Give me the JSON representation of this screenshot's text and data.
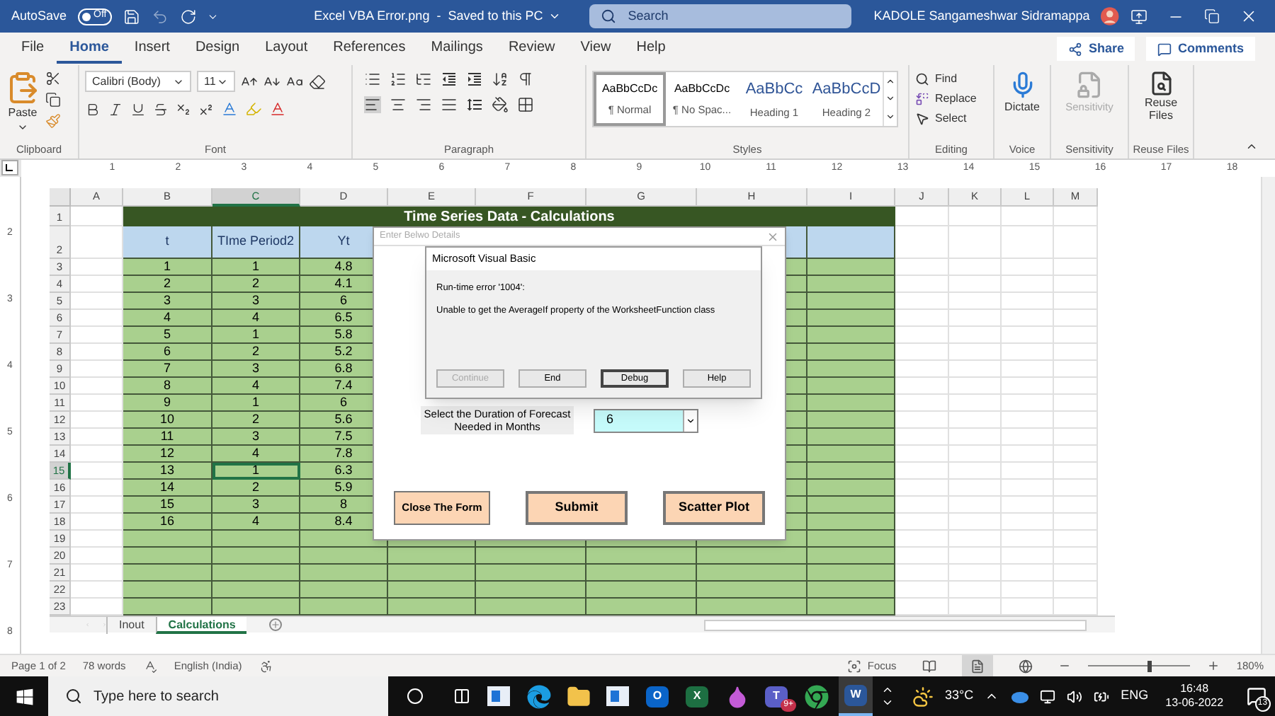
{
  "title_bar": {
    "autosave_label": "AutoSave",
    "autosave": {
      "on": false,
      "label": "Off"
    },
    "document_title": "Excel VBA Error.png  -  Saved to this PC",
    "search_placeholder": "Search",
    "user_name": "KADOLE Sangameshwar Sidramappa"
  },
  "ribbon_tabs": [
    {
      "label": "File",
      "selected": false
    },
    {
      "label": "Home",
      "selected": true
    },
    {
      "label": "Insert",
      "selected": false
    },
    {
      "label": "Design",
      "selected": false
    },
    {
      "label": "Layout",
      "selected": false
    },
    {
      "label": "References",
      "selected": false
    },
    {
      "label": "Mailings",
      "selected": false
    },
    {
      "label": "Review",
      "selected": false
    },
    {
      "label": "View",
      "selected": false
    },
    {
      "label": "Help",
      "selected": false
    }
  ],
  "share": "Share",
  "comments": "Comments",
  "ribbon": {
    "clipboard": {
      "paste": "Paste",
      "group": "Clipboard"
    },
    "font": {
      "name": "Calibri (Body)",
      "size": "11",
      "group": "Font"
    },
    "paragraph": {
      "group": "Paragraph"
    },
    "styles": {
      "group": "Styles",
      "items": [
        {
          "sample": "AaBbCcDc",
          "name": "¶ Normal",
          "selected": true,
          "kind": "body"
        },
        {
          "sample": "AaBbCcDc",
          "name": "¶ No Spac...",
          "selected": false,
          "kind": "body"
        },
        {
          "sample": "AaBbCc",
          "name": "Heading 1",
          "selected": false,
          "kind": "heading"
        },
        {
          "sample": "AaBbCcD",
          "name": "Heading 2",
          "selected": false,
          "kind": "heading"
        }
      ]
    },
    "editing": {
      "group": "Editing",
      "find": "Find",
      "replace": "Replace",
      "select": "Select"
    },
    "voice": {
      "group": "Voice",
      "button": "Dictate"
    },
    "sensitivity": {
      "group": "Sensitivity",
      "button": "Sensitivity",
      "disabled": true
    },
    "reuse_files": {
      "group": "Reuse Files",
      "button": "Reuse Files"
    }
  },
  "ruler": {
    "horizontal": [
      "1",
      "2",
      "3",
      "4",
      "5",
      "6",
      "7",
      "8",
      "9",
      "10",
      "11",
      "12",
      "13",
      "14",
      "15",
      "16",
      "17",
      "18"
    ],
    "vertical": [
      "2",
      "3",
      "4",
      "5",
      "6",
      "7",
      "8"
    ]
  },
  "sheet": {
    "columns": [
      {
        "label": "A",
        "selected": false
      },
      {
        "label": "B",
        "selected": false
      },
      {
        "label": "C",
        "selected": true
      },
      {
        "label": "D",
        "selected": false
      },
      {
        "label": "E",
        "selected": false
      },
      {
        "label": "F",
        "selected": false
      },
      {
        "label": "G",
        "selected": false
      },
      {
        "label": "H",
        "selected": false
      },
      {
        "label": "I",
        "selected": false
      },
      {
        "label": "J",
        "selected": false
      },
      {
        "label": "K",
        "selected": false
      },
      {
        "label": "L",
        "selected": false
      },
      {
        "label": "M",
        "selected": false
      }
    ],
    "row_numbers": [
      "1",
      "2",
      "3",
      "4",
      "5",
      "6",
      "7",
      "8",
      "9",
      "10",
      "11",
      "12",
      "13",
      "14",
      "15",
      "16",
      "17",
      "18",
      "19",
      "20",
      "21",
      "22",
      "23"
    ],
    "title": "Time Series Data - Calculations",
    "header_row": {
      "cells": [
        "",
        "t",
        "TIme Period2",
        "Yt"
      ]
    },
    "rows": [
      {
        "cells": [
          "",
          "1",
          "1",
          "4.8"
        ],
        "selected": false
      },
      {
        "cells": [
          "",
          "2",
          "2",
          "4.1"
        ],
        "selected": false
      },
      {
        "cells": [
          "",
          "3",
          "3",
          "6"
        ],
        "selected": false
      },
      {
        "cells": [
          "",
          "4",
          "4",
          "6.5"
        ],
        "selected": false
      },
      {
        "cells": [
          "",
          "5",
          "1",
          "5.8"
        ],
        "selected": false
      },
      {
        "cells": [
          "",
          "6",
          "2",
          "5.2"
        ],
        "selected": false
      },
      {
        "cells": [
          "",
          "7",
          "3",
          "6.8"
        ],
        "selected": false
      },
      {
        "cells": [
          "",
          "8",
          "4",
          "7.4"
        ],
        "selected": false
      },
      {
        "cells": [
          "",
          "9",
          "1",
          "6"
        ],
        "selected": false
      },
      {
        "cells": [
          "",
          "10",
          "2",
          "5.6"
        ],
        "selected": false
      },
      {
        "cells": [
          "",
          "11",
          "3",
          "7.5"
        ],
        "selected": false
      },
      {
        "cells": [
          "",
          "12",
          "4",
          "7.8"
        ],
        "selected": false
      },
      {
        "cells": [
          "",
          "13",
          "1",
          "6.3"
        ],
        "selected": true
      },
      {
        "cells": [
          "",
          "14",
          "2",
          "5.9"
        ],
        "selected": false
      },
      {
        "cells": [
          "",
          "15",
          "3",
          "8"
        ],
        "selected": false
      },
      {
        "cells": [
          "",
          "16",
          "4",
          "8.4"
        ],
        "selected": false
      }
    ],
    "tabs": [
      {
        "label": "Inout",
        "selected": false
      },
      {
        "label": "Calculations",
        "selected": true
      }
    ]
  },
  "userform": {
    "title": "Enter Belwo Details",
    "label": "Select the Duration of Forecast Needed in Months",
    "combo_value": "6",
    "buttons": [
      "Close The Form",
      "Submit",
      "Scatter Plot"
    ]
  },
  "error_dialog": {
    "title": "Microsoft Visual Basic",
    "error": "Run-time error '1004':",
    "message": "Unable to get the AverageIf property of the WorksheetFunction class",
    "buttons": [
      {
        "label": "Continue",
        "disabled": true,
        "selected": false
      },
      {
        "label": "End",
        "disabled": false,
        "selected": false
      },
      {
        "label": "Debug",
        "disabled": false,
        "selected": true
      },
      {
        "label": "Help",
        "disabled": false,
        "selected": false
      }
    ]
  },
  "status_bar": {
    "page": "Page 1 of 2",
    "words": "78 words",
    "language": "English (India)",
    "focus": "Focus",
    "views": [
      {
        "kind": "read",
        "selected": false
      },
      {
        "kind": "print",
        "selected": true
      },
      {
        "kind": "web",
        "selected": false
      }
    ],
    "zoom": {
      "level": 0.6,
      "label": "180%"
    }
  },
  "taskbar": {
    "search_placeholder": "Type here to search",
    "apps": [
      {
        "kind": "window",
        "color": "#1e73d6",
        "selected": false
      },
      {
        "kind": "edge",
        "color": "#1b9de2",
        "selected": false
      },
      {
        "kind": "folder",
        "color": "#f2c24b",
        "selected": false
      },
      {
        "kind": "window",
        "color": "#1e73d6",
        "selected": false
      },
      {
        "kind": "letter",
        "letter": "O",
        "color": "#0a64c8",
        "selected": false
      },
      {
        "kind": "letter",
        "letter": "X",
        "color": "#1d6f42",
        "selected": false
      },
      {
        "kind": "drop",
        "color": "#c35bd6",
        "selected": false
      },
      {
        "kind": "letter",
        "letter": "T",
        "color": "#5b5fc7",
        "badge": "9+",
        "selected": false
      },
      {
        "kind": "chrome",
        "color": "#34a853",
        "selected": false
      },
      {
        "kind": "letter",
        "letter": "W",
        "color": "#2b579a",
        "selected": true
      }
    ],
    "temperature": "33°C",
    "language": "ENG",
    "time": "16:48",
    "date": "13-06-2022",
    "notifications": "13"
  }
}
